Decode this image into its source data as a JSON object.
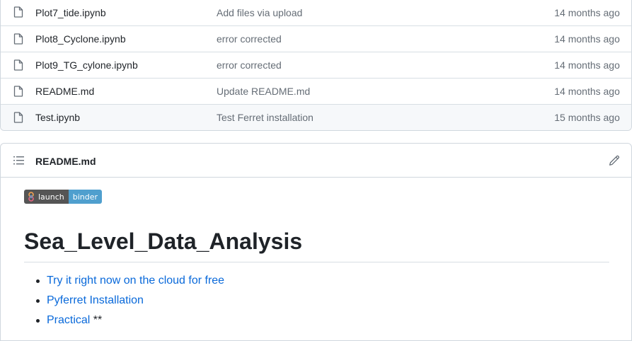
{
  "files": [
    {
      "name": "Plot7_tide.ipynb",
      "message": "Add files via upload",
      "date": "14 months ago"
    },
    {
      "name": "Plot8_Cyclone.ipynb",
      "message": "error corrected",
      "date": "14 months ago"
    },
    {
      "name": "Plot9_TG_cylone.ipynb",
      "message": "error corrected",
      "date": "14 months ago"
    },
    {
      "name": "README.md",
      "message": "Update README.md",
      "date": "14 months ago"
    },
    {
      "name": "Test.ipynb",
      "message": "Test Ferret installation",
      "date": "15 months ago"
    }
  ],
  "readme": {
    "title": "README.md",
    "badge": {
      "left": "launch",
      "right": "binder"
    },
    "heading": "Sea_Level_Data_Analysis",
    "links": [
      {
        "text": "Try it right now on the cloud for free",
        "suffix": ""
      },
      {
        "text": "Pyferret Installation",
        "suffix": ""
      },
      {
        "text": "Practical",
        "suffix": " **"
      }
    ]
  },
  "colors": {
    "link": "#0969da",
    "muted": "#656d76",
    "badge_left": "#555555",
    "badge_right": "#4f9fce"
  }
}
